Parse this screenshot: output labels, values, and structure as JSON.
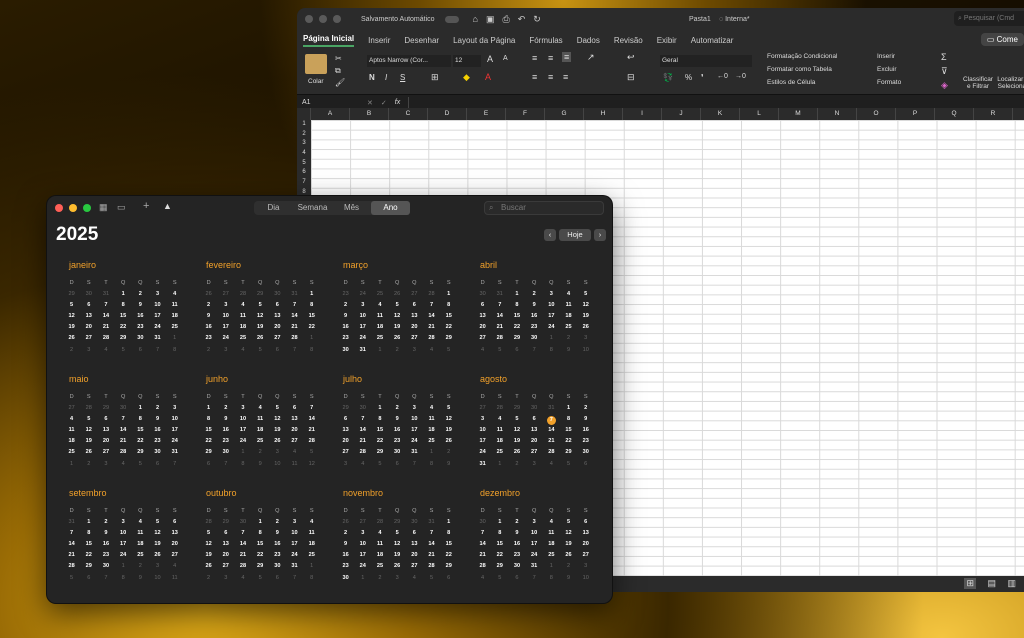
{
  "excel": {
    "title_left": "Salvamento Automático",
    "doc_title": "Pasta1",
    "sensitivity": "Interna*",
    "search_placeholder": "Pesquisar (Cmd",
    "comment_btn": "Come",
    "tabs": [
      "Página Inicial",
      "Inserir",
      "Desenhar",
      "Layout da Página",
      "Fórmulas",
      "Dados",
      "Revisão",
      "Exibir",
      "Automatizar"
    ],
    "paste_label": "Colar",
    "font_name": "Aptos Narrow (Cor...",
    "font_size": "12",
    "number_format": "Geral",
    "styles": [
      "Formatação Condicional",
      "Formatar como Tabela",
      "Estilos de Célula"
    ],
    "cells_ops": [
      "Inserir",
      "Excluir",
      "Formato"
    ],
    "sort_label": "Classificar e Filtrar",
    "find_label": "Localizar e Selecionar",
    "name_box": "A1",
    "fx": "fx",
    "columns": [
      "A",
      "B",
      "C",
      "D",
      "E",
      "F",
      "G",
      "H",
      "I",
      "J",
      "K",
      "L",
      "M",
      "N",
      "O",
      "P",
      "Q",
      "R"
    ],
    "rows": [
      "1",
      "2",
      "3",
      "4",
      "5",
      "6",
      "7",
      "8"
    ]
  },
  "calendar": {
    "views": [
      "Dia",
      "Semana",
      "Mês",
      "Ano"
    ],
    "selected_view": "Ano",
    "search_placeholder": "Buscar",
    "year": "2025",
    "today_btn": "Hoje",
    "weekdays": [
      "D",
      "S",
      "T",
      "Q",
      "Q",
      "S",
      "S"
    ],
    "today": {
      "month": 7,
      "day": 7
    },
    "months": [
      "janeiro",
      "fevereiro",
      "março",
      "abril",
      "maio",
      "junho",
      "julho",
      "agosto",
      "setembro",
      "outubro",
      "novembro",
      "dezembro"
    ]
  },
  "colors": {
    "accent": "#f2a12a",
    "excel_green": "#4aa564"
  }
}
